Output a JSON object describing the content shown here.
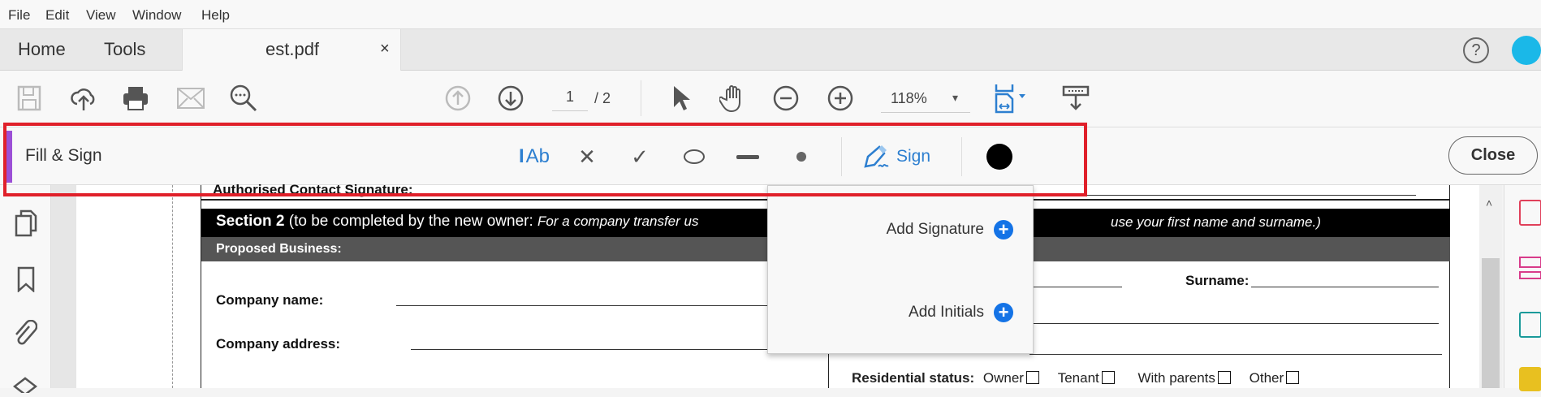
{
  "menu": [
    "File",
    "Edit",
    "View",
    "Window",
    "Help"
  ],
  "tabs": {
    "home": "Home",
    "tools": "Tools",
    "document": "est.pdf",
    "close": "×"
  },
  "toolbar": {
    "page_current": "1",
    "page_total": "/ 2",
    "zoom": "118%",
    "dropdown": "▾"
  },
  "fill_sign": {
    "title": "Fill & Sign",
    "text_tool": "Ab",
    "cross": "✕",
    "check": "✓",
    "sign_label": "Sign",
    "close_label": "Close",
    "ink_color": "#000000"
  },
  "popup": {
    "add_signature": "Add Signature",
    "add_initials": "Add Initials",
    "plus": "+"
  },
  "document": {
    "contact_signature": "Authorised Contact Signature:",
    "section_title": "Section 2",
    "section_note": " (to be completed by the new owner: ",
    "section_italic_left": "For a company transfer us",
    "section_italic_right": "use your first name and surname.)",
    "proposed_business": "Proposed Business:",
    "company_name": "Company name:",
    "company_address": "Company address:",
    "surname": "Surname:",
    "residential_status": "Residential status:",
    "status_options": [
      "Owner",
      "Tenant",
      "With parents",
      "Other"
    ]
  },
  "colors": {
    "accent": "#1473e6",
    "highlight": "#e0202a",
    "fill_sign_bar": "#9b4fd6"
  }
}
